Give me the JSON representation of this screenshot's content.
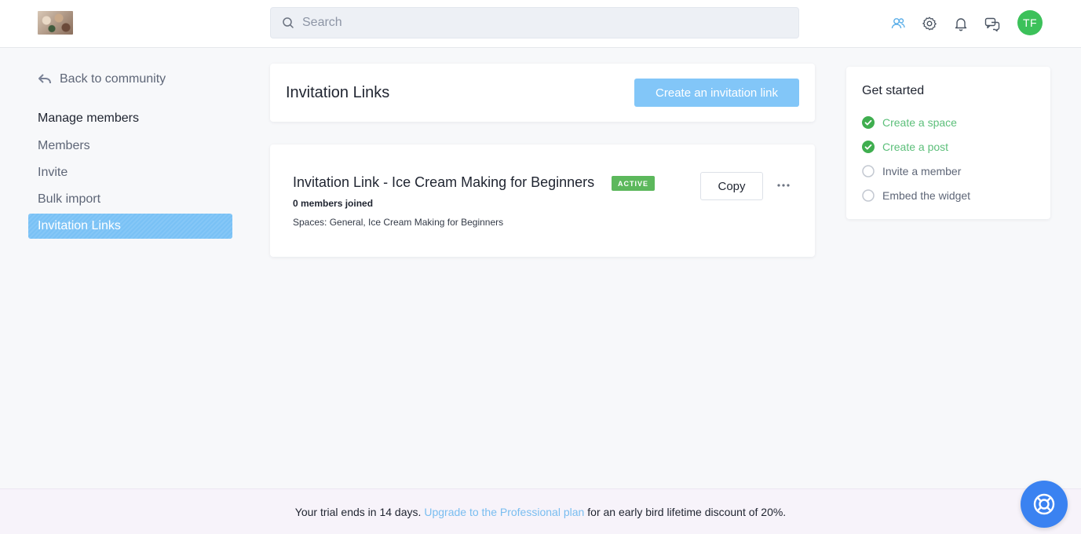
{
  "header": {
    "search_placeholder": "Search",
    "avatar_initials": "TF",
    "icons": [
      "members-icon",
      "gear-icon",
      "bell-icon",
      "chat-icon"
    ]
  },
  "sidebar": {
    "back_label": "Back to community",
    "heading": "Manage members",
    "items": [
      {
        "label": "Members",
        "active": false
      },
      {
        "label": "Invite",
        "active": false
      },
      {
        "label": "Bulk import",
        "active": false
      },
      {
        "label": "Invitation Links",
        "active": true
      }
    ]
  },
  "main": {
    "title": "Invitation Links",
    "create_label": "Create an invitation link",
    "link": {
      "title": "Invitation Link - Ice Cream Making for Beginners",
      "status": "ACTIVE",
      "joined": "0 members joined",
      "spaces": "Spaces: General, Ice Cream Making for Beginners",
      "copy_label": "Copy",
      "more_label": "•••"
    }
  },
  "get_started": {
    "title": "Get started",
    "items": [
      {
        "label": "Create a space",
        "done": true
      },
      {
        "label": "Create a post",
        "done": true
      },
      {
        "label": "Invite a member",
        "done": false
      },
      {
        "label": "Embed the widget",
        "done": false
      }
    ]
  },
  "trial": {
    "prefix": "Your trial ends in 14 days.",
    "link": "Upgrade to the Professional plan",
    "suffix": "for an early bird lifetime discount of 20%."
  },
  "colors": {
    "accent": "#82c6f8",
    "success": "#5cb85c",
    "avatar": "#3cc15a",
    "help": "#3a82f1"
  }
}
